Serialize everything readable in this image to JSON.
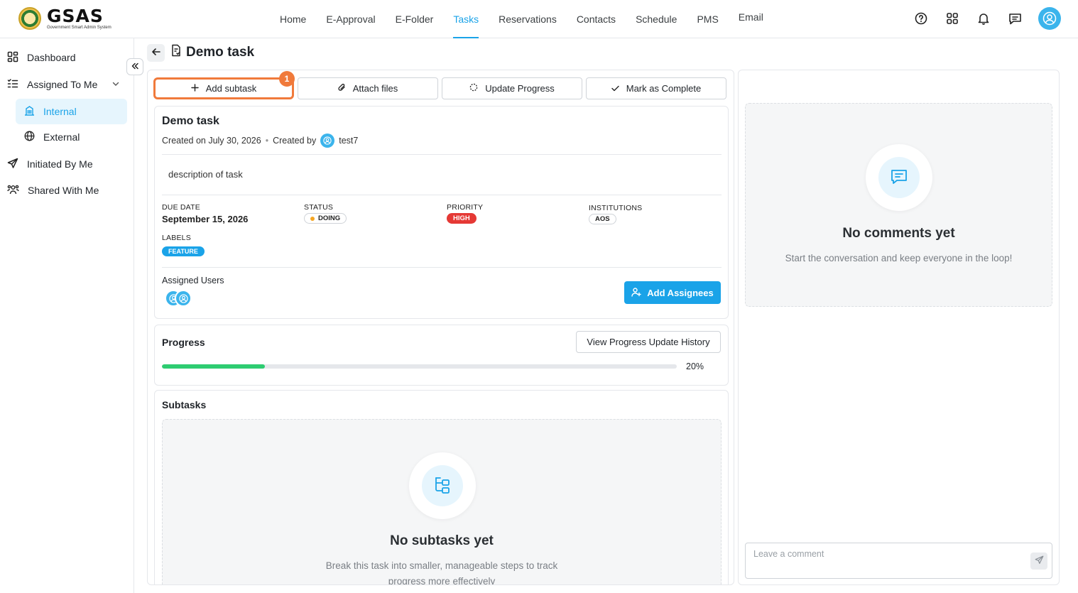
{
  "brand": {
    "name": "GSAS",
    "subtitle": "Government Smart Admin System"
  },
  "nav": {
    "items": [
      {
        "label": "Home"
      },
      {
        "label": "E-Approval"
      },
      {
        "label": "E-Folder"
      },
      {
        "label": "Tasks",
        "active": true
      },
      {
        "label": "Reservations"
      },
      {
        "label": "Contacts"
      },
      {
        "label": "Schedule"
      },
      {
        "label": "PMS"
      },
      {
        "label": "Email"
      }
    ]
  },
  "header_icons": [
    "help-icon",
    "apps-grid-icon",
    "bell-icon",
    "chat-icon",
    "user-avatar"
  ],
  "sidebar": {
    "items": [
      {
        "label": "Dashboard",
        "icon": "dashboard-icon"
      },
      {
        "label": "Assigned To Me",
        "icon": "list-check-icon",
        "expanded": true
      },
      {
        "label": "Internal",
        "icon": "building-icon",
        "active": true
      },
      {
        "label": "External",
        "icon": "globe-icon"
      },
      {
        "label": "Initiated By Me",
        "icon": "send-icon"
      },
      {
        "label": "Shared With Me",
        "icon": "users-icon"
      }
    ]
  },
  "page": {
    "title": "Demo task"
  },
  "actions": {
    "add_subtask": "Add subtask",
    "attach_files": "Attach files",
    "update_progress": "Update Progress",
    "mark_complete": "Mark as Complete",
    "marker": "1"
  },
  "task": {
    "title": "Demo task",
    "created_on": "Created on July 30, 2026",
    "separator": "•",
    "created_by_label": "Created by",
    "created_by": "test7",
    "description": "description of task",
    "due_date_label": "DUE DATE",
    "due_date": "September 15, 2026",
    "status_label": "STATUS",
    "status": "DOING",
    "priority_label": "PRIORITY",
    "priority": "HIGH",
    "institutions_label": "INSTITUTIONS",
    "institution": "AOS",
    "labels_label": "LABELS",
    "label": "FEATURE",
    "assigned_users_label": "Assigned Users",
    "add_assignees": "Add Assignees",
    "colors": {
      "accent": "#1aa3e8",
      "high": "#e53935",
      "status_dot": "#f5a623",
      "progress": "#2ecc71",
      "highlight": "#f07a3b"
    }
  },
  "progress": {
    "title": "Progress",
    "history_button": "View Progress Update History",
    "value": 0.2,
    "percent_text": "20%"
  },
  "subtasks": {
    "title": "Subtasks",
    "empty_title": "No subtasks yet",
    "empty_line1": "Break this task into smaller, manageable steps to track",
    "empty_line2": "progress more effectively"
  },
  "comments": {
    "empty_title": "No comments yet",
    "empty_sub": "Start the conversation and keep everyone in the loop!",
    "input_placeholder": "Leave a comment"
  }
}
